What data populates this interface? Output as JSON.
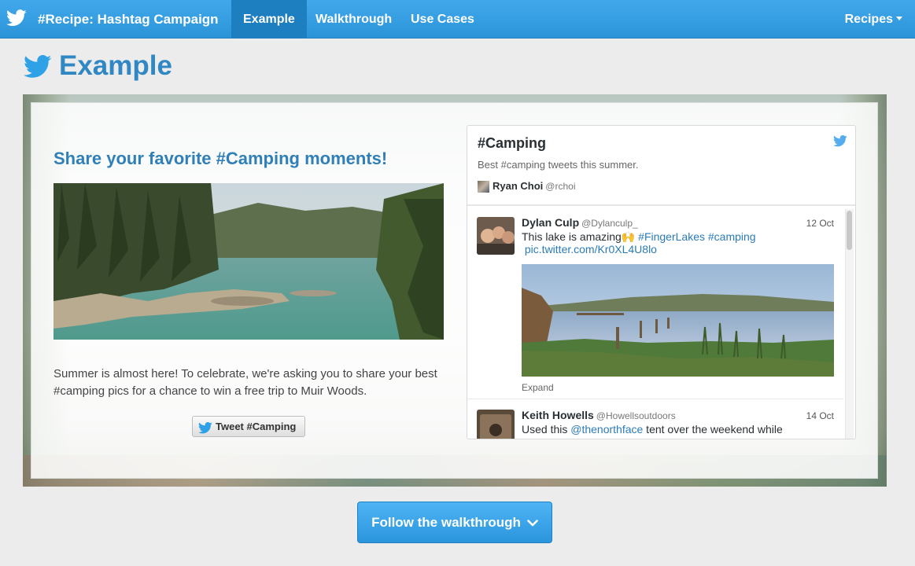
{
  "navbar": {
    "brand": "#Recipe: Hashtag Campaign",
    "tabs": [
      "Example",
      "Walkthrough",
      "Use Cases"
    ],
    "active_tab": "Example",
    "right_menu": "Recipes"
  },
  "page": {
    "title": "Example"
  },
  "card": {
    "heading": "Share your favorite #Camping moments!",
    "body": "Summer is almost here! To celebrate, we're asking you to share your best #camping pics for a chance to win a free trip to Muir Woods.",
    "tweet_button": "Tweet #Camping"
  },
  "timeline": {
    "title": "#Camping",
    "description": "Best #camping tweets this summer.",
    "author_name": "Ryan Choi",
    "author_handle": "@rchoi",
    "tweets": [
      {
        "name": "Dylan Culp",
        "handle": "@Dylanculp_",
        "date": "12 Oct",
        "text_plain": "This lake is amazing🙌 ",
        "hashtag_1": "#FingerLakes",
        "hashtag_2": "#camping",
        "link": "pic.twitter.com/Kr0XL4U8lo",
        "expand": "Expand"
      },
      {
        "name": "Keith Howells",
        "handle": "@Howellsoutdoors",
        "date": "14 Oct",
        "text_plain": "Used this ",
        "mention": "@thenorthface",
        "text_after": " tent over the weekend while"
      }
    ]
  },
  "cta": {
    "label": "Follow the walkthrough"
  },
  "colors": {
    "brand_blue": "#2b94d8",
    "link": "#2b7bb9",
    "heading": "#2f7fb8"
  },
  "icons": [
    "twitter-bird-icon",
    "caret-down-icon",
    "chevron-down-icon"
  ]
}
